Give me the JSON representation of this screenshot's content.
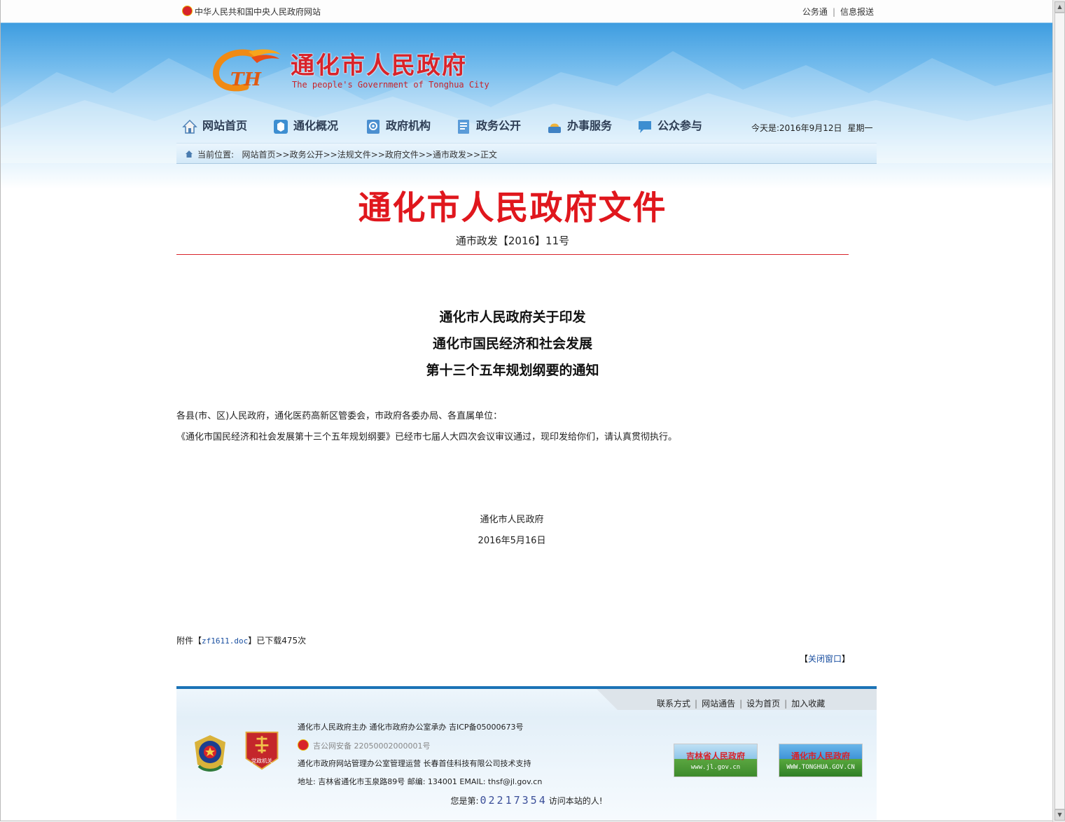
{
  "topbar": {
    "central_gov_link": "中华人民共和国中央人民政府网站",
    "links": [
      "公务通",
      "信息报送"
    ]
  },
  "logo": {
    "title": "通化市人民政府",
    "subtitle": "The people's Government of Tonghua City",
    "mark_letters": "TH"
  },
  "nav": {
    "items": [
      {
        "label": "网站首页",
        "icon": "home-icon"
      },
      {
        "label": "通化概况",
        "icon": "overview-icon"
      },
      {
        "label": "政府机构",
        "icon": "institution-icon"
      },
      {
        "label": "政务公开",
        "icon": "disclosure-icon"
      },
      {
        "label": "办事服务",
        "icon": "service-icon"
      },
      {
        "label": "公众参与",
        "icon": "participation-icon"
      }
    ],
    "date_label": "今天是:2016年9月12日",
    "weekday": "星期一"
  },
  "breadcrumb": {
    "label": "当前位置:",
    "path": "网站首页>>政务公开>>法规文件>>政府文件>>通市政发>>正文"
  },
  "document": {
    "header": "通化市人民政府文件",
    "number": "通市政发【2016】11号",
    "title_lines": [
      "通化市人民政府关于印发",
      "通化市国民经济和社会发展",
      "第十三个五年规划纲要的通知"
    ],
    "addressee": "各县(市、区)人民政府，通化医药高新区管委会，市政府各委办局、各直属单位：",
    "body": "《通化市国民经济和社会发展第十三个五年规划纲要》已经市七届人大四次会议审议通过，现印发给你们，请认真贯彻执行。",
    "signature_org": "通化市人民政府",
    "signature_date": "2016年5月16日"
  },
  "attachment": {
    "prefix": "附件【",
    "file": "zf1611.doc",
    "suffix": "】已下载475次"
  },
  "close_window": {
    "open": "【",
    "label": "关闭窗口",
    "close": "】"
  },
  "footer": {
    "links": [
      "联系方式",
      "网站通告",
      "设为首页",
      "加入收藏"
    ],
    "badge_label": "党政机关",
    "host_line": "通化市人民政府主办 通化市政府办公室承办 吉ICP备05000673号",
    "police_record": "吉公网安备 22050002000001号",
    "operator_line": "通化市政府网站管理办公室管理运营 长春首佳科技有限公司技术支持",
    "address_line": "地址: 吉林省通化市玉泉路89号 邮编: 134001 EMAIL: thsf@jl.gov.cn",
    "counter_prefix": "您是第:",
    "counter_digits": "02217354",
    "counter_suffix": "访问本站的人!",
    "banners": [
      {
        "title": "吉林省人民政府",
        "url": "www.jl.gov.cn"
      },
      {
        "title": "通化市人民政府",
        "url": "WWW.TONGHUA.GOV.CN"
      }
    ]
  },
  "colors": {
    "header_red": "#e0171d",
    "footer_blue": "#1b73b6",
    "link_blue": "#1a4fa0"
  }
}
